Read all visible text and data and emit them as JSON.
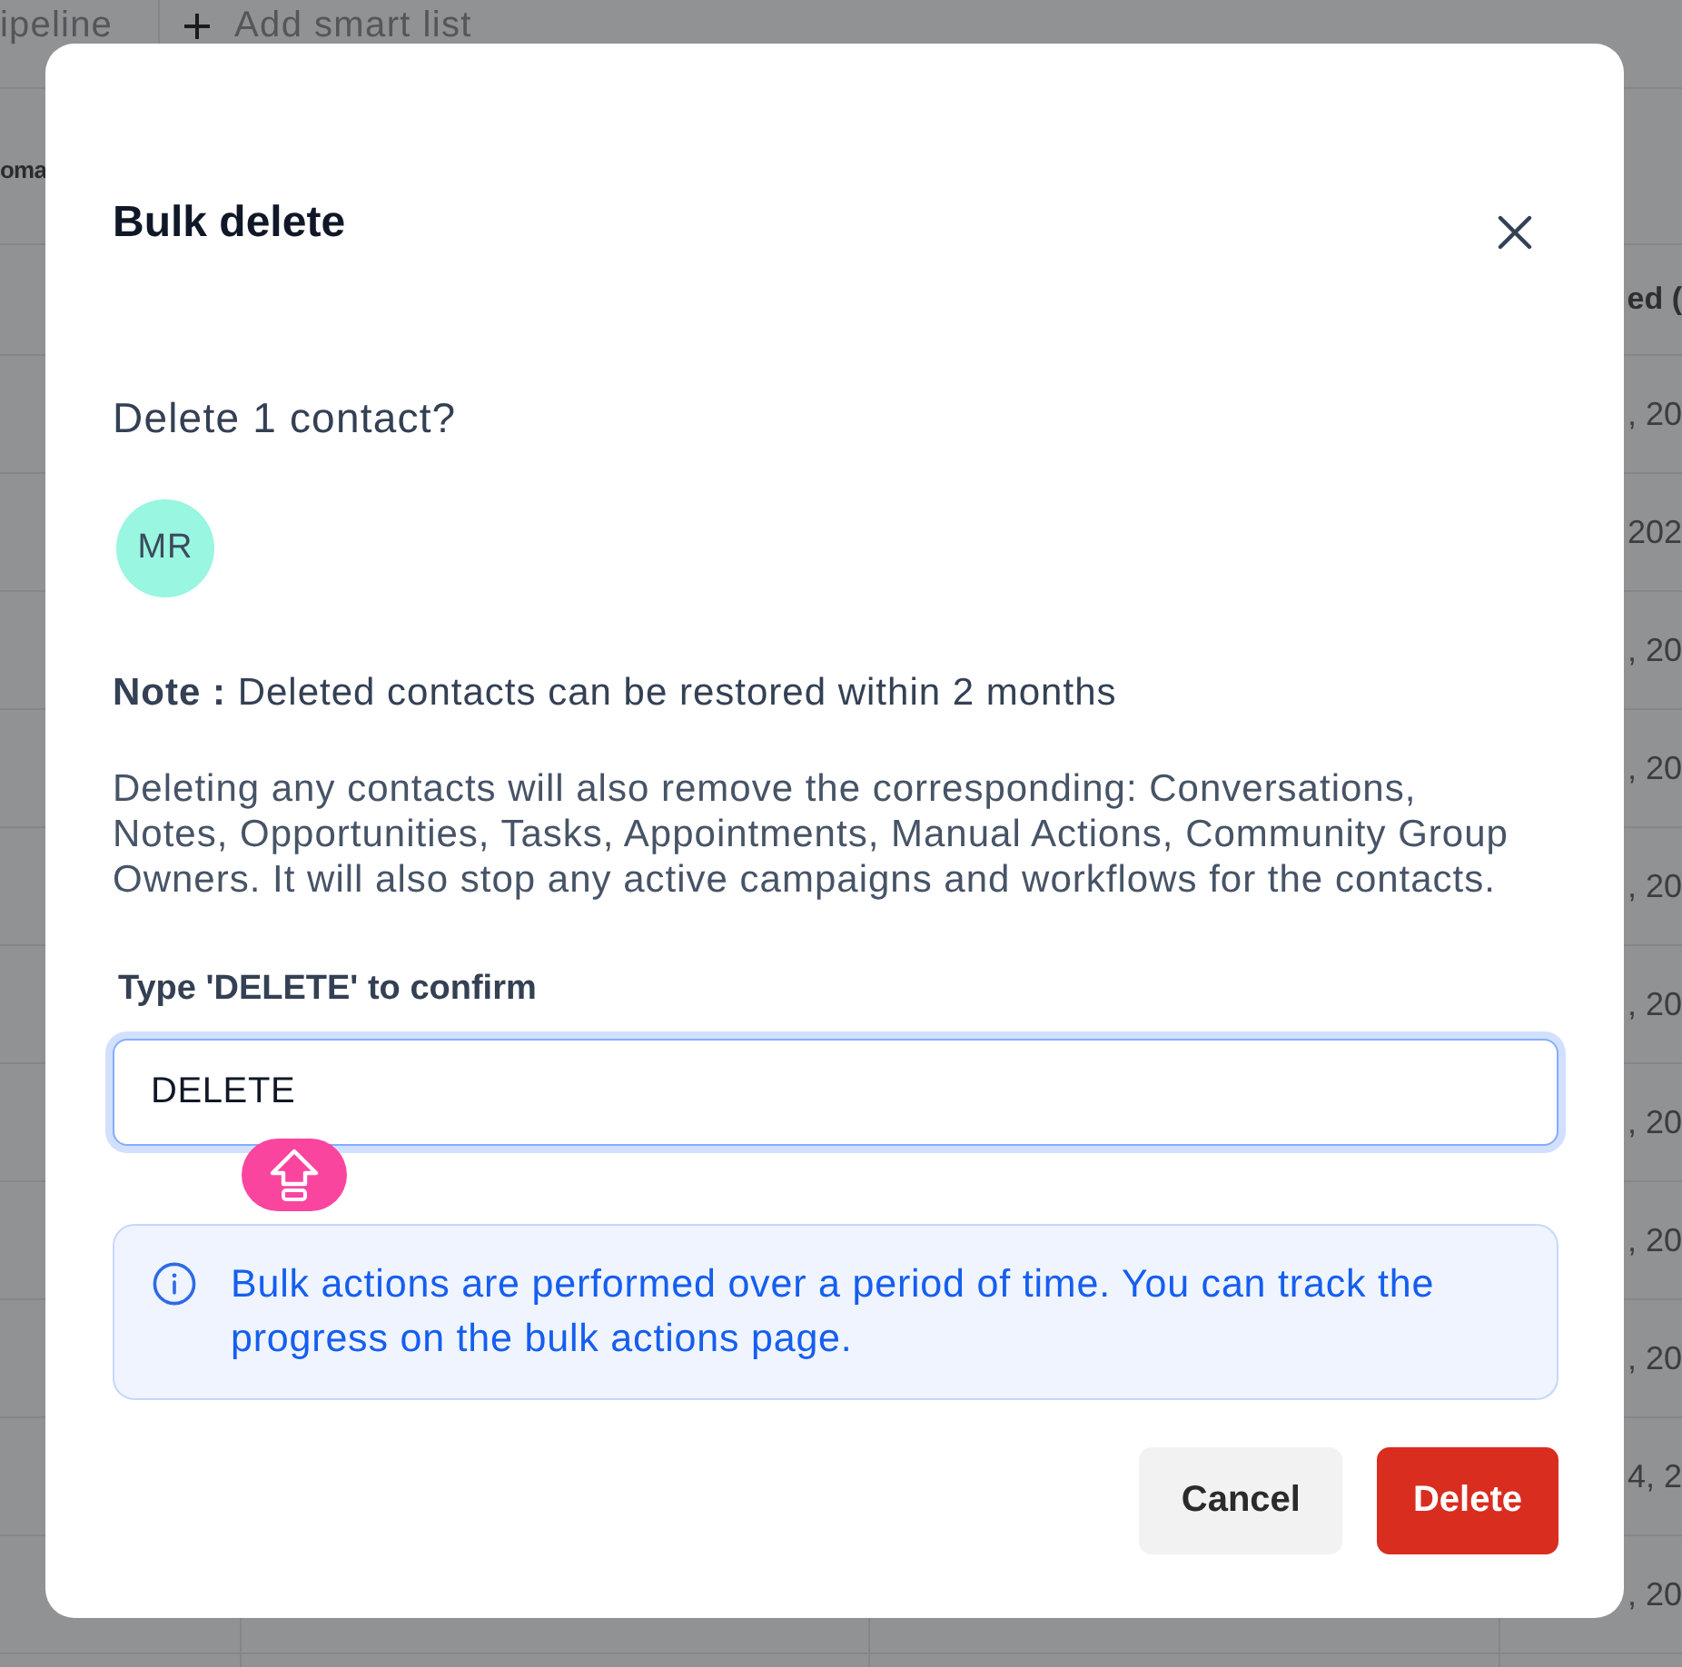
{
  "background": {
    "top_bar": {
      "tab": "ipeline",
      "add_button": "Add smart list"
    },
    "toolbar": {
      "label": "oma"
    },
    "table": {
      "header": "ed (",
      "cells": [
        ", 20",
        "202",
        ", 20",
        ", 20",
        ", 20",
        ", 20",
        ", 20",
        ", 20",
        ", 20",
        "4, 2",
        ", 20"
      ]
    }
  },
  "dialog": {
    "title": "Bulk delete",
    "heading": "Delete 1 contact?",
    "avatar": {
      "initials": "MR"
    },
    "note": "**Note :** Deleted contacts can be restored within 2 months",
    "description": "Deleting any contacts will also remove the corresponding: Conversations, Notes, Opportunities, Tasks, Appointments, Manual Actions, Community Group Owners. It will also stop any active campaigns and workflows for the contacts.",
    "confirm_field": {
      "label": "Type 'DELETE' to confirm",
      "value": "DELETE",
      "focused": true,
      "caps_lock": true
    },
    "info": "Bulk actions are performed over a period of time. You can track the progress on the bulk actions page.",
    "buttons": [
      {
        "label": "Cancel",
        "kind": "secondary"
      },
      {
        "label": "Delete",
        "kind": "danger"
      }
    ]
  }
}
